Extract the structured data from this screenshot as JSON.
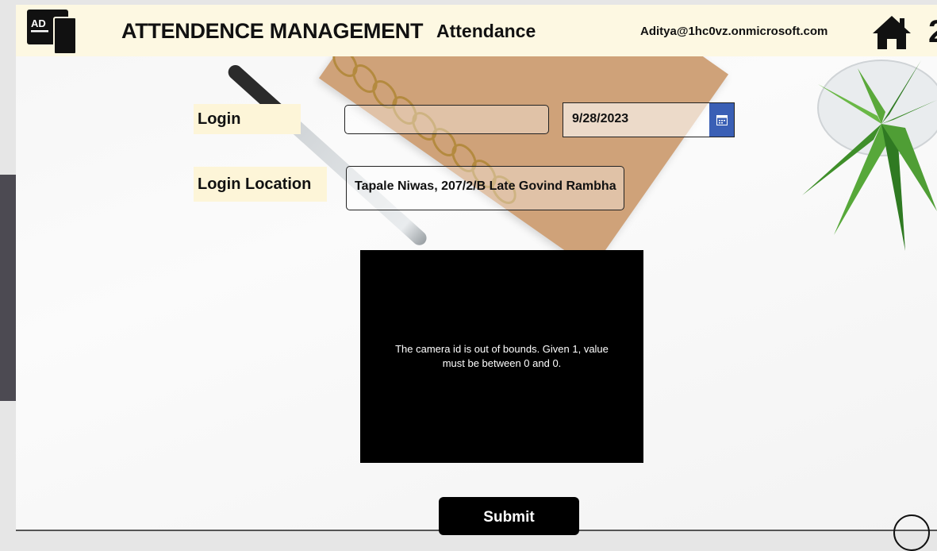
{
  "header": {
    "logo_text": "AD",
    "app_title": "ATTENDENCE MANAGEMENT",
    "page_title": "Attendance",
    "user_email": "Aditya@1hc0vz.onmicrosoft.com",
    "home_icon": "home-icon"
  },
  "form": {
    "login_label": "Login",
    "login_value": "",
    "date_value": "9/28/2023",
    "calendar_icon": "calendar-icon",
    "location_label": "Login Location",
    "location_value": "Tapale Niwas, 207/2/B Late Govind Rambha"
  },
  "camera": {
    "message": "The camera id is out of bounds. Given 1, value must be between 0 and 0."
  },
  "submit_label": "Submit",
  "colors": {
    "header_bg": "#fdf8e2",
    "label_bg": "#fdf5d8",
    "date_button": "#3a5fb5",
    "camera_bg": "#000000"
  }
}
